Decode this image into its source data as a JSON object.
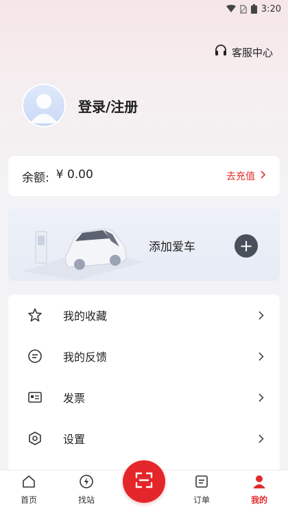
{
  "status_bar": {
    "time": "3:20"
  },
  "header": {
    "service_label": "客服中心",
    "service_icon": "headset-icon"
  },
  "profile": {
    "login_label": "登录/注册",
    "avatar_icon": "default-avatar"
  },
  "balance": {
    "label": "余额:",
    "value": "¥ 0.00",
    "recharge_label": "去充值"
  },
  "car": {
    "add_label": "添加爱车",
    "add_icon": "plus-icon"
  },
  "menu": [
    {
      "label": "我的收藏",
      "icon": "star-icon"
    },
    {
      "label": "我的反馈",
      "icon": "feedback-icon"
    },
    {
      "label": "发票",
      "icon": "invoice-icon"
    },
    {
      "label": "设置",
      "icon": "settings-icon"
    }
  ],
  "tabs": [
    {
      "label": "首页",
      "icon": "home-icon"
    },
    {
      "label": "找站",
      "icon": "charging-icon"
    },
    {
      "label": "",
      "icon": "scan-icon"
    },
    {
      "label": "订单",
      "icon": "order-icon"
    },
    {
      "label": "我的",
      "icon": "user-icon",
      "active": true
    }
  ],
  "colors": {
    "accent": "#e22a2a",
    "scan_bg": "#e4262a",
    "add_btn": "#4a505b"
  }
}
